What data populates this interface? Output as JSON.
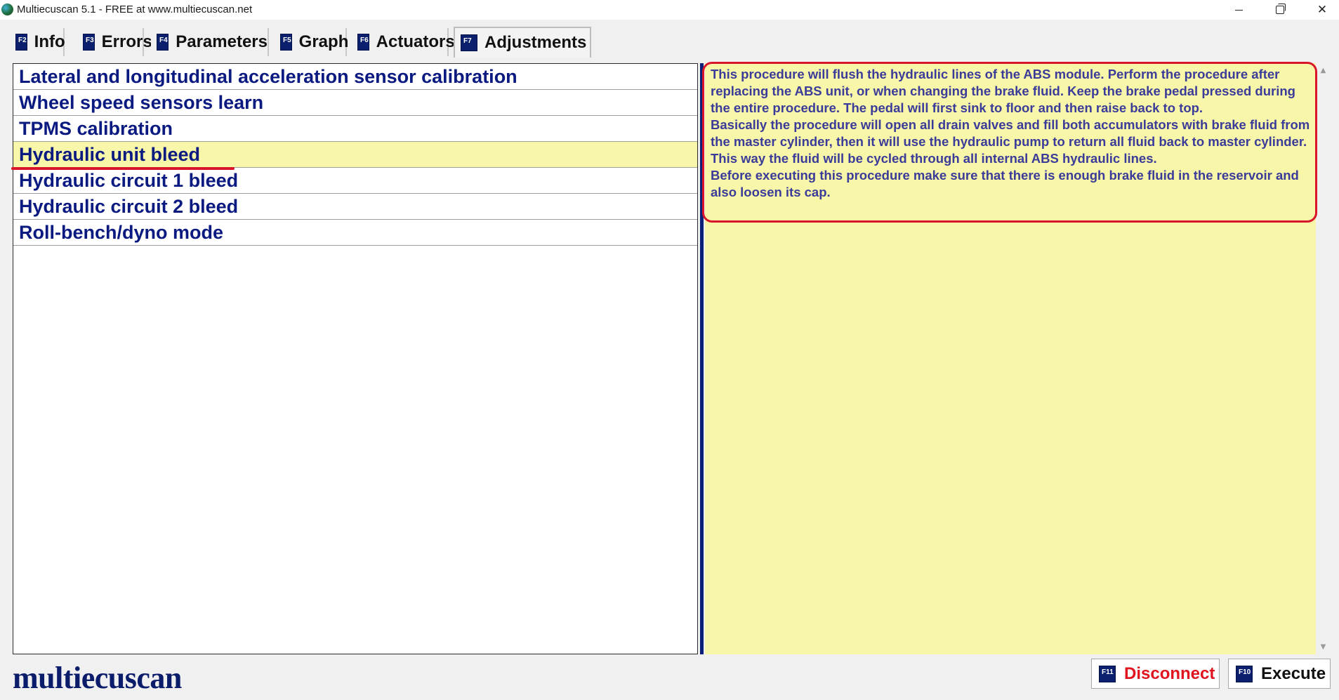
{
  "window": {
    "title": "Multiecuscan 5.1 - FREE at www.multiecuscan.net",
    "close_glyph": "✕"
  },
  "tabs": [
    {
      "key": "F2",
      "label": "Info"
    },
    {
      "key": "F3",
      "label": "Errors"
    },
    {
      "key": "F4",
      "label": "Parameters"
    },
    {
      "key": "F5",
      "label": "Graph"
    },
    {
      "key": "F6",
      "label": "Actuators"
    },
    {
      "key": "F7",
      "label": "Adjustments"
    }
  ],
  "active_tab": "Adjustments",
  "procedures": [
    "Lateral and longitudinal acceleration sensor calibration",
    "Wheel speed sensors learn",
    "TPMS calibration",
    "Hydraulic unit bleed",
    "Hydraulic circuit 1 bleed",
    "Hydraulic circuit 2 bleed",
    "Roll-bench/dyno mode"
  ],
  "selected_procedure": "Hydraulic unit bleed",
  "description": {
    "para1": "This procedure will flush the hydraulic lines of the ABS module. Perform the procedure after replacing the ABS unit, or when changing the brake fluid. Keep the brake pedal pressed during the entire procedure. The pedal will first sink to floor and then raise back to top.",
    "para2": "Basically the procedure will open all drain valves and fill both accumulators with brake fluid from the master cylinder, then it will use the hydraulic pump to return all fluid back to master cylinder. This way the fluid will be cycled through all internal ABS hydraulic lines.",
    "para3": "Before executing this procedure make sure that there is enough brake fluid in the reservoir and also loosen its cap."
  },
  "logo": "multiecuscan",
  "buttons": {
    "disconnect": {
      "key": "F11",
      "label": "Disconnect"
    },
    "execute": {
      "key": "F10",
      "label": "Execute"
    }
  },
  "scroll": {
    "up": "▲",
    "down": "▼"
  },
  "colors": {
    "accent_navy": "#0b1e78",
    "selection_yellow": "#f8f6a8",
    "annotation_red": "#d8152a",
    "disconnect_red": "#e0141f"
  }
}
